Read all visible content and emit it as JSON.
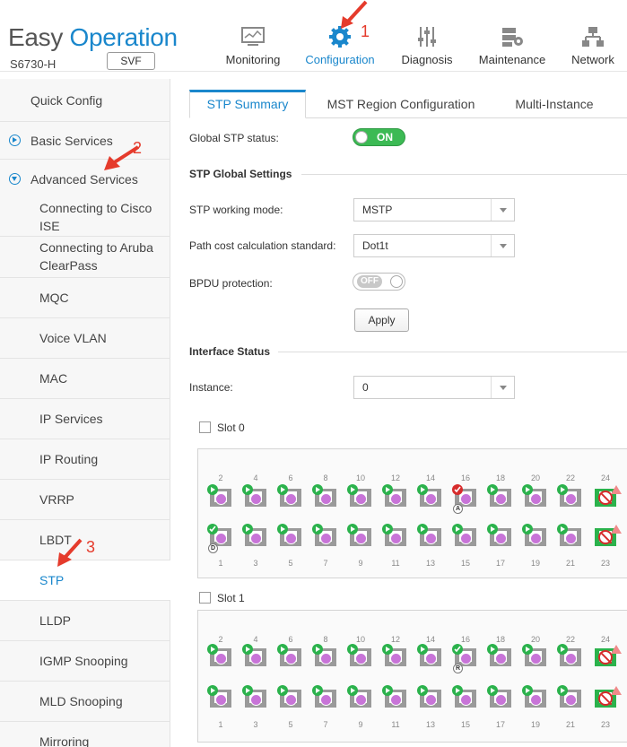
{
  "brand": {
    "word1": "Easy",
    "word2": "Operation",
    "model": "S6730-H",
    "svf_label": "SVF"
  },
  "nav": [
    {
      "label": "Monitoring",
      "icon": "monitor-icon"
    },
    {
      "label": "Configuration",
      "icon": "gear-icon",
      "active": true
    },
    {
      "label": "Diagnosis",
      "icon": "sliders-icon"
    },
    {
      "label": "Maintenance",
      "icon": "maintenance-icon"
    },
    {
      "label": "Network",
      "icon": "network-topology-icon"
    }
  ],
  "callouts": {
    "c1": "1",
    "c2": "2",
    "c3": "3"
  },
  "sidebar": {
    "quick_config": "Quick Config",
    "basic_services": "Basic Services",
    "advanced_services": "Advanced Services",
    "items": [
      "Connecting to Cisco ISE",
      "Connecting to Aruba ClearPass",
      "MQC",
      "Voice VLAN",
      "MAC",
      "IP Services",
      "IP Routing",
      "VRRP",
      "LBDT",
      "STP",
      "LLDP",
      "IGMP Snooping",
      "MLD Snooping",
      "Mirroring"
    ]
  },
  "tabs": [
    "STP Summary",
    "MST Region Configuration",
    "Multi-Instance"
  ],
  "form": {
    "global_stp_status_label": "Global STP status:",
    "global_stp_status_value": "ON",
    "stp_global_settings": "STP Global Settings",
    "working_mode_label": "STP working mode:",
    "working_mode_value": "MSTP",
    "path_cost_label": "Path cost calculation standard:",
    "path_cost_value": "Dot1t",
    "bpdu_label": "BPDU protection:",
    "bpdu_value": "OFF",
    "apply_label": "Apply",
    "interface_status": "Interface Status",
    "instance_label": "Instance:",
    "instance_value": "0"
  },
  "slots": [
    {
      "label": "Slot 0",
      "top_ports": [
        "2",
        "4",
        "6",
        "8",
        "10",
        "12",
        "14",
        "16",
        "18",
        "20",
        "22",
        "24"
      ],
      "bottom_ports": [
        "1",
        "3",
        "5",
        "7",
        "9",
        "11",
        "13",
        "15",
        "17",
        "19",
        "21",
        "23"
      ],
      "top_badge": {
        "port": "16",
        "text": "A"
      },
      "bottom_badge": {
        "port": "1",
        "text": "D"
      }
    },
    {
      "label": "Slot 1",
      "top_ports": [
        "2",
        "4",
        "6",
        "8",
        "10",
        "12",
        "14",
        "16",
        "18",
        "20",
        "22",
        "24"
      ],
      "bottom_ports": [
        "1",
        "3",
        "5",
        "7",
        "9",
        "11",
        "13",
        "15",
        "17",
        "19",
        "21",
        "23"
      ],
      "top_badge": {
        "port": "16",
        "text": "R"
      },
      "bottom_badge": null
    }
  ],
  "colors": {
    "accent": "#1a87cc",
    "on_green": "#3cba54",
    "port_forwarding": "#2bb24c",
    "callout_red": "#e53b2c"
  }
}
